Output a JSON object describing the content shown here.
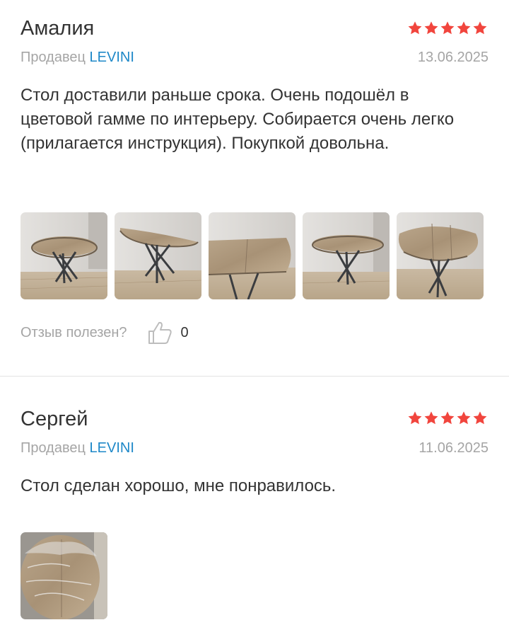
{
  "reviews": [
    {
      "author": "Амалия",
      "rating": 5,
      "seller_prefix": "Продавец",
      "seller_name": "LEVINI",
      "date": "13.06.2025",
      "text": "Стол доставили раньше срока. Очень подошёл в цветовой гамме по интерьеру. Собирается очень легко (прилагается инструкция). Покупкой довольна.",
      "photos": [
        "table-photo-1",
        "table-photo-2",
        "table-photo-3",
        "table-photo-4",
        "table-photo-5"
      ],
      "helpful_label": "Отзыв полезен?",
      "helpful_icon": "thumbs-up-icon",
      "helpful_count": "0"
    },
    {
      "author": "Сергей",
      "rating": 5,
      "seller_prefix": "Продавец",
      "seller_name": "LEVINI",
      "date": "11.06.2025",
      "text": "Стол сделан хорошо, мне понравилось.",
      "photos": [
        "table-photo-1"
      ]
    }
  ],
  "colors": {
    "star": "#f1453d",
    "link": "#1e88c8",
    "muted": "#a5a5a5",
    "text": "#333333"
  }
}
